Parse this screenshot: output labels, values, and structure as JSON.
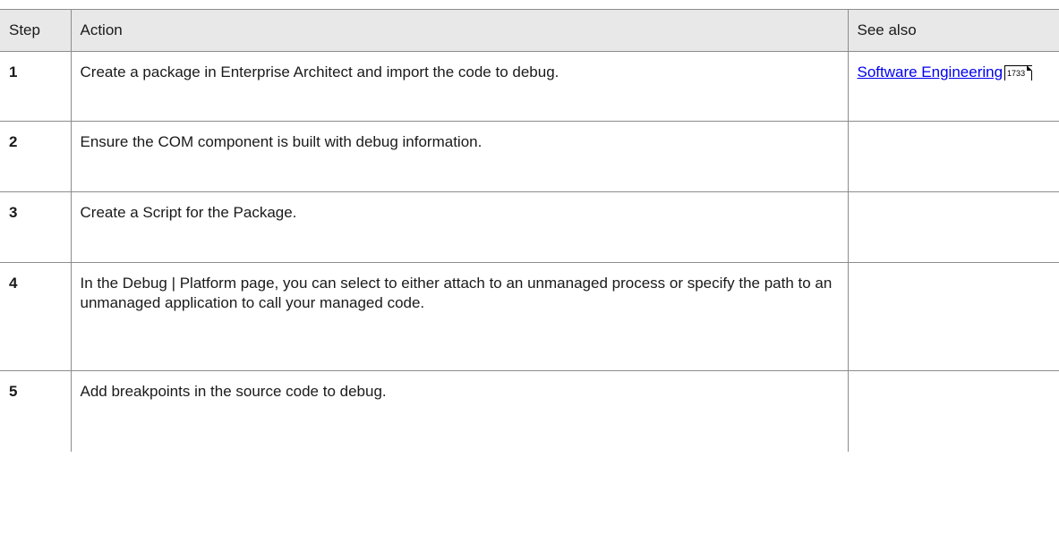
{
  "table": {
    "headers": {
      "step": "Step",
      "action": "Action",
      "see_also": "See also"
    },
    "rows": [
      {
        "step": "1",
        "action": "Create a package in Enterprise Architect and import the code to debug.",
        "see_also_link": "Software Engineering",
        "see_also_page": "1733"
      },
      {
        "step": "2",
        "action": "Ensure the COM component is built with debug information."
      },
      {
        "step": "3",
        "action": "Create a Script for the Package."
      },
      {
        "step": "4",
        "action": "In the Debug | Platform page, you can select to either attach to an unmanaged process or specify the path to an unmanaged application to call your managed code."
      },
      {
        "step": "5",
        "action": "Add breakpoints in the source code to debug."
      }
    ]
  }
}
